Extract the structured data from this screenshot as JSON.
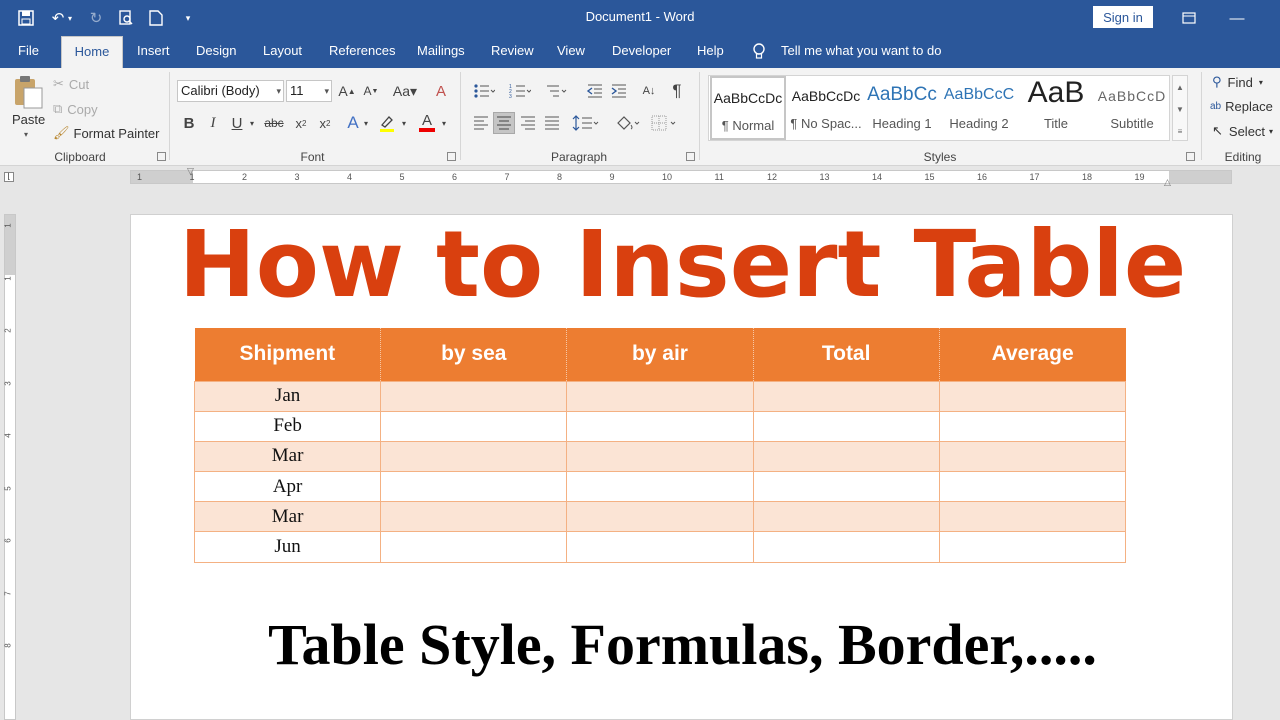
{
  "window": {
    "title": "Document1  -  Word",
    "signin": "Sign in"
  },
  "tabs": [
    "File",
    "Home",
    "Insert",
    "Design",
    "Layout",
    "References",
    "Mailings",
    "Review",
    "View",
    "Developer",
    "Help"
  ],
  "tell_me": "Tell me what you want to do",
  "clipboard": {
    "paste": "Paste",
    "cut": "Cut",
    "copy": "Copy",
    "format_painter": "Format Painter",
    "label": "Clipboard"
  },
  "font": {
    "name": "Calibri (Body)",
    "size": "11",
    "label": "Font"
  },
  "paragraph": {
    "label": "Paragraph"
  },
  "styles": {
    "label": "Styles",
    "items": [
      {
        "preview": "AaBbCcDc",
        "name": "¶ Normal"
      },
      {
        "preview": "AaBbCcDc",
        "name": "¶ No Spac..."
      },
      {
        "preview": "AaBbCc",
        "name": "Heading 1"
      },
      {
        "preview": "AaBbCcC",
        "name": "Heading 2"
      },
      {
        "preview": "AaB",
        "name": "Title"
      },
      {
        "preview": "AaBbCcD",
        "name": "Subtitle"
      }
    ]
  },
  "editing": {
    "find": "Find",
    "replace": "Replace",
    "select": "Select",
    "label": "Editing"
  },
  "ruler_ticks": [
    "1",
    "1",
    "2",
    "3",
    "4",
    "5",
    "6",
    "7",
    "8",
    "9",
    "10",
    "11",
    "12",
    "13",
    "14",
    "15",
    "16",
    "17",
    "18",
    "19"
  ],
  "vruler_ticks": [
    "1",
    "1",
    "2",
    "3",
    "4",
    "5",
    "6",
    "7",
    "8"
  ],
  "document": {
    "heading": "How to Insert Table",
    "table": {
      "headers": [
        "Shipment",
        "by sea",
        "by air",
        "Total",
        "Average"
      ],
      "rows": [
        [
          "Jan",
          "",
          "",
          "",
          ""
        ],
        [
          "Feb",
          "",
          "",
          "",
          ""
        ],
        [
          "Mar",
          "",
          "",
          "",
          ""
        ],
        [
          "Apr",
          "",
          "",
          "",
          ""
        ],
        [
          "Mar",
          "",
          "",
          "",
          ""
        ],
        [
          "Jun",
          "",
          "",
          "",
          ""
        ]
      ]
    },
    "subtitle": "Table Style, Formulas, Border,....."
  },
  "colors": {
    "ribbon_blue": "#2b579a",
    "heading_red": "#d9400f",
    "table_orange": "#ed7d31",
    "row_tint": "#fbe4d5"
  }
}
